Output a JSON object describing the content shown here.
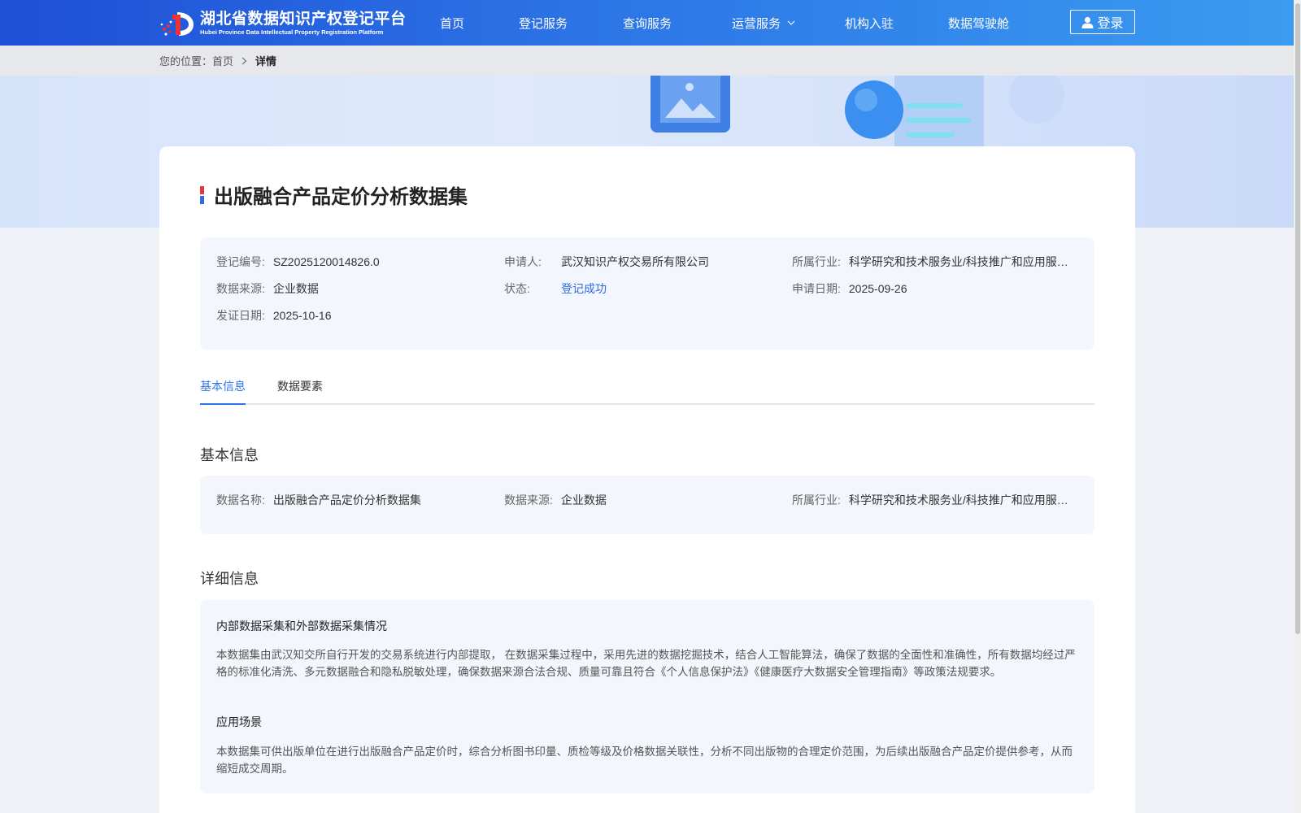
{
  "header": {
    "logo_title": "湖北省数据知识产权登记平台",
    "logo_subtitle": "Hubei Province Data Intellectual Property Registration Platform",
    "nav": [
      {
        "label": "首页"
      },
      {
        "label": "登记服务"
      },
      {
        "label": "查询服务"
      },
      {
        "label": "运营服务",
        "has_dropdown": true
      },
      {
        "label": "机构入驻"
      },
      {
        "label": "数据驾驶舱"
      }
    ],
    "login_label": "登录"
  },
  "breadcrumb": {
    "prefix": "您的位置：",
    "home": "首页",
    "current": "详情"
  },
  "detail": {
    "title": "出版融合产品定价分析数据集",
    "summary": {
      "reg_no_label": "登记编号:",
      "reg_no": "SZ2025120014826.0",
      "applicant_label": "申请人:",
      "applicant": "武汉知识产权交易所有限公司",
      "industry_label": "所属行业:",
      "industry": "科学研究和技术服务业/科技推广和应用服务业",
      "source_label": "数据来源:",
      "source": "企业数据",
      "status_label": "状态:",
      "status": "登记成功",
      "apply_date_label": "申请日期:",
      "apply_date": "2025-09-26",
      "cert_date_label": "发证日期:",
      "cert_date": "2025-10-16"
    },
    "tabs": [
      {
        "label": "基本信息",
        "active": true
      },
      {
        "label": "数据要素",
        "active": false
      }
    ],
    "basic": {
      "section_title": "基本信息",
      "name_label": "数据名称:",
      "name": "出版融合产品定价分析数据集",
      "source_label": "数据来源:",
      "source": "企业数据",
      "industry_label": "所属行业:",
      "industry": "科学研究和技术服务业/科技推广和应用服务业"
    },
    "more": {
      "section_title": "详细信息",
      "collection_title": "内部数据采集和外部数据采集情况",
      "collection_text": "本数据集由武汉知交所自行开发的交易系统进行内部提取， 在数据采集过程中，采用先进的数据挖掘技术，结合人工智能算法，确保了数据的全面性和准确性，所有数据均经过严格的标准化清洗、多元数据融合和隐私脱敏处理，确保数据来源合法合规、质量可靠且符合《个人信息保护法》《健康医疗大数据安全管理指南》等政策法规要求。",
      "scenario_title": "应用场景",
      "scenario_text": "本数据集可供出版单位在进行出版融合产品定价时，综合分析图书印量、质检等级及价格数据关联性，分析不同出版物的合理定价范围，为后续出版融合产品定价提供参考，从而缩短成交周期。"
    }
  },
  "colors": {
    "header_start": "#1e4fd6",
    "header_end": "#3a9cf0",
    "accent": "#2d74e6",
    "panel_bg": "#f3f6fc"
  }
}
